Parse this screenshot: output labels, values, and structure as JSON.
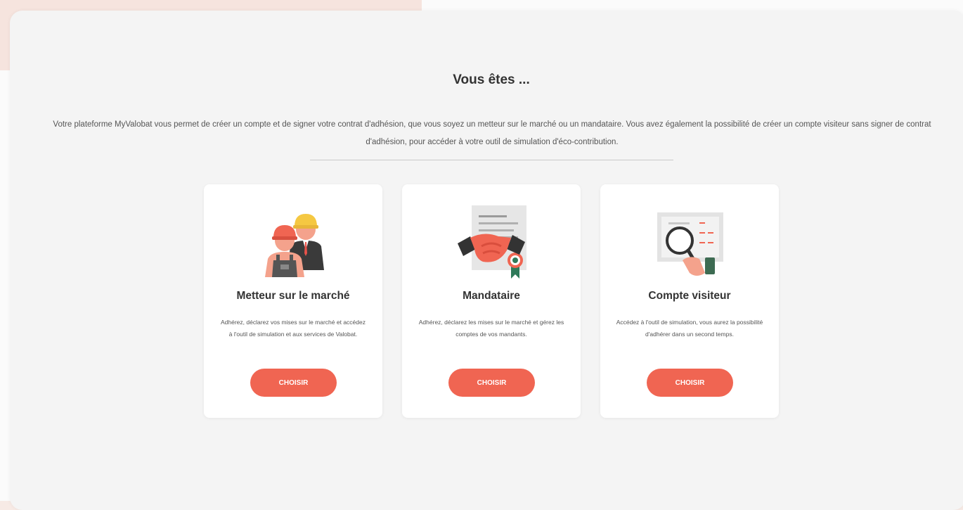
{
  "page": {
    "title": "Vous êtes ...",
    "intro": "Votre plateforme MyValobat vous permet de créer un compte et de signer votre contrat d'adhésion, que vous soyez un metteur sur le marché ou un mandataire. Vous avez également la possibilité de créer un compte visiteur sans signer de contrat d'adhésion, pour accéder à votre outil de simulation d'éco-contribution."
  },
  "cards": [
    {
      "title": "Metteur sur le marché",
      "description": "Adhérez, déclarez vos mises sur le marché et accédez à l'outil de simulation et aux services de Valobat.",
      "button_label": "CHOISIR",
      "icon": "workers-icon"
    },
    {
      "title": "Mandataire",
      "description": "Adhérez, déclarez les mises sur le marché et gérez les comptes de vos mandants.",
      "button_label": "CHOISIR",
      "icon": "handshake-contract-icon"
    },
    {
      "title": "Compte visiteur",
      "description": "Accédez à l'outil de simulation, vous aurez la possibilité d'adhérer dans un second temps.",
      "button_label": "CHOISIR",
      "icon": "magnifier-document-icon"
    }
  ],
  "colors": {
    "accent": "#f06552",
    "panel_bg": "#f4f4f4",
    "card_bg": "#ffffff"
  }
}
